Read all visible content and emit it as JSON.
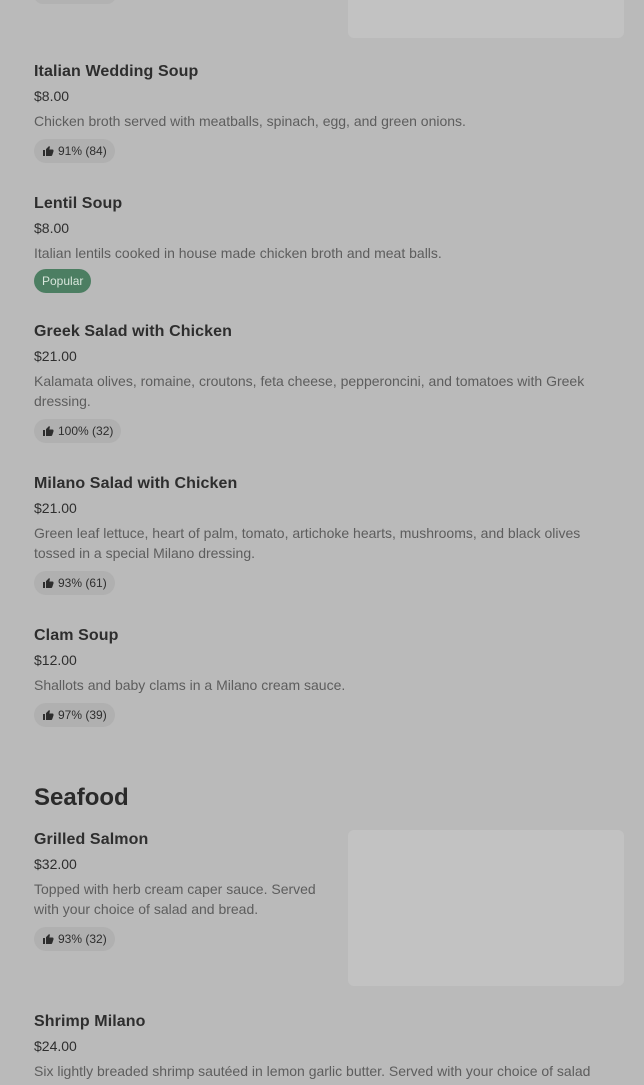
{
  "menu": {
    "items_top": [
      {
        "name": "Italian Wedding Soup",
        "price": "$8.00",
        "description": "Chicken broth served with meatballs, spinach, egg, and green onions.",
        "rating": "91% (84)"
      },
      {
        "name": "Lentil Soup",
        "price": "$8.00",
        "description": "Italian lentils cooked in house made chicken broth and meat balls.",
        "tag": "Popular"
      },
      {
        "name": "Greek Salad with Chicken",
        "price": "$21.00",
        "description": "Kalamata olives, romaine, croutons, feta cheese, pepperoncini, and tomatoes with Greek dressing.",
        "rating": "100% (32)"
      },
      {
        "name": "Milano Salad with Chicken",
        "price": "$21.00",
        "description": "Green leaf lettuce, heart of palm, tomato, artichoke hearts, mushrooms, and black olives tossed in a special Milano dressing.",
        "rating": "93% (61)"
      },
      {
        "name": "Clam Soup",
        "price": "$12.00",
        "description": "Shallots and baby clams in a Milano cream sauce.",
        "rating": "97% (39)"
      }
    ],
    "seafood": {
      "title": "Seafood",
      "items": [
        {
          "name": "Grilled Salmon",
          "price": "$32.00",
          "description": "Topped with herb cream caper sauce. Served with your choice of salad and bread.",
          "rating": "93% (32)"
        },
        {
          "name": "Shrimp Milano",
          "price": "$24.00",
          "description": "Six lightly breaded shrimp sautéed in lemon garlic butter. Served with your choice of salad"
        }
      ]
    }
  },
  "icons": {
    "rating": "thumbs-up-icon"
  },
  "colors": {
    "background": "#bababa",
    "popular_badge": "#4c7e62",
    "rating_badge": "#b0b0b0"
  }
}
